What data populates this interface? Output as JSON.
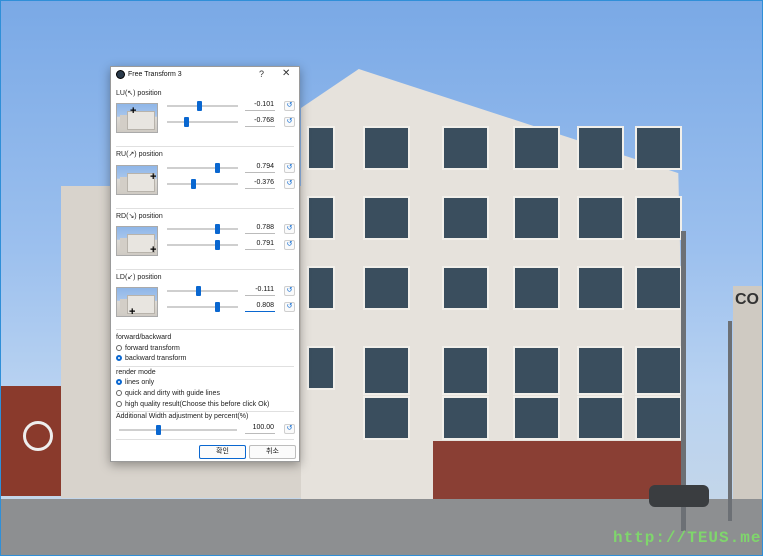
{
  "dialog": {
    "title": "Free Transform 3",
    "help": "?",
    "close": "✕"
  },
  "corners": [
    {
      "label": "LU(↖) position",
      "marker": "+",
      "x_value": "-0.101",
      "y_value": "-0.768",
      "x_slider": 0.45,
      "y_slider": 0.25
    },
    {
      "label": "RU(↗) position",
      "marker": "+",
      "x_value": "0.794",
      "y_value": "-0.376",
      "x_slider": 0.72,
      "y_slider": 0.37
    },
    {
      "label": "RD(↘) position",
      "marker": "+",
      "x_value": "0.788",
      "y_value": "0.791",
      "x_slider": 0.72,
      "y_slider": 0.72
    },
    {
      "label": "LD(↙) position",
      "marker": "+",
      "x_value": "-0.111",
      "y_value": "0.808",
      "x_slider": 0.44,
      "y_slider": 0.73
    }
  ],
  "direction": {
    "label": "forward/backward",
    "options": [
      "forward transform",
      "backward transform"
    ],
    "selected": 1
  },
  "render": {
    "label": "render mode",
    "options": [
      "lines only",
      "quick and dirty with guide lines",
      "high quality result(Choose this before click Ok)"
    ],
    "selected": 0
  },
  "width_adjust": {
    "label": "Additional Width adjustment by percent(%)",
    "value": "100.00",
    "slider": 0.33
  },
  "buttons": {
    "ok": "확인",
    "cancel": "취소"
  },
  "reset_icon": "↺",
  "scene": {
    "watermark": "http://TEUS.me",
    "sign_right": "CO"
  }
}
